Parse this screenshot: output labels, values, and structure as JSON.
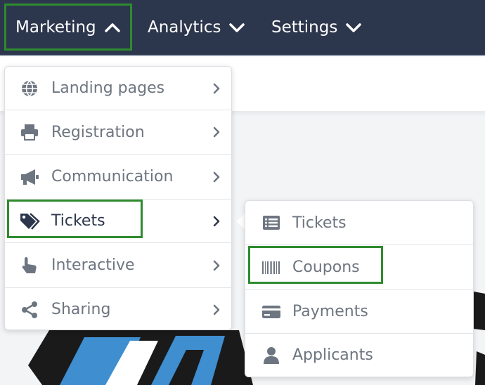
{
  "nav": {
    "items": [
      {
        "label": "Marketing",
        "state": "expanded"
      },
      {
        "label": "Analytics",
        "state": "collapsed"
      },
      {
        "label": "Settings",
        "state": "collapsed"
      }
    ]
  },
  "menu": {
    "items": [
      {
        "label": "Landing pages",
        "icon": "globe-icon"
      },
      {
        "label": "Registration",
        "icon": "printer-icon"
      },
      {
        "label": "Communication",
        "icon": "megaphone-icon"
      },
      {
        "label": "Tickets",
        "icon": "tag-icon",
        "active": true
      },
      {
        "label": "Interactive",
        "icon": "hand-pointer-icon"
      },
      {
        "label": "Sharing",
        "icon": "share-icon"
      }
    ]
  },
  "submenu": {
    "items": [
      {
        "label": "Tickets",
        "icon": "list-icon"
      },
      {
        "label": "Coupons",
        "icon": "barcode-icon",
        "highlighted": true
      },
      {
        "label": "Payments",
        "icon": "credit-card-icon"
      },
      {
        "label": "Applicants",
        "icon": "user-icon"
      }
    ]
  },
  "colors": {
    "topbar": "#2c364c",
    "highlight": "#2e8b2e",
    "menu_text": "#6d7580",
    "active_text": "#2c364c"
  }
}
